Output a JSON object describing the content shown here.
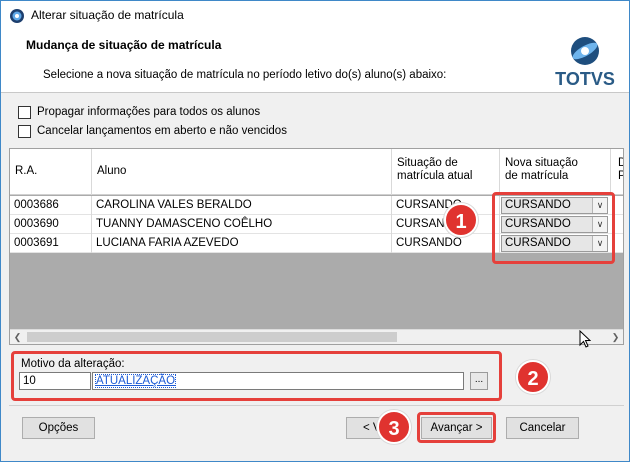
{
  "window": {
    "title": "Alterar situação de matrícula"
  },
  "header": {
    "title": "Mudança de situação de matrícula",
    "subtitle": "Selecione a nova situação de matrícula no período letivo do(s) aluno(s) abaixo:",
    "logo_text": "TOTVS"
  },
  "options": {
    "propagate_label": "Propagar informações para todos os alunos",
    "propagate_checked": false,
    "cancel_label": "Cancelar lançamentos em aberto e não vencidos",
    "cancel_checked": false
  },
  "grid": {
    "columns": [
      "R.A.",
      "Aluno",
      "Situação de matrícula atual",
      "Nova situação de matrícula",
      "D P"
    ],
    "col_ra": "R.A.",
    "col_aluno": "Aluno",
    "col_sit_1": "Situação de",
    "col_sit_2": "matrícula atual",
    "col_nova_1": "Nova situação",
    "col_nova_2": "de matrícula",
    "col_extra_1": "D",
    "col_extra_2": "P",
    "rows": [
      {
        "ra": "0003686",
        "aluno": "CAROLINA VALES BERALDO",
        "atual": "CURSANDO",
        "nova": "CURSANDO"
      },
      {
        "ra": "0003690",
        "aluno": "TUANNY DAMASCENO COÊLHO",
        "atual": "CURSANDO",
        "nova": "CURSANDO"
      },
      {
        "ra": "0003691",
        "aluno": "LUCIANA FARIA AZEVEDO",
        "atual": "CURSANDO",
        "nova": "CURSANDO"
      }
    ]
  },
  "motivo": {
    "label": "Motivo da alteração:",
    "code": "10",
    "description": "ATUALIZAÇÃO",
    "lookup_label": "..."
  },
  "buttons": {
    "options": "Opções",
    "back": "< V",
    "next": "Avançar >",
    "cancel": "Cancelar"
  },
  "annotations": [
    "1",
    "2",
    "3"
  ],
  "colors": {
    "highlight": "#e5403b",
    "badge": "#e0332f",
    "logo": "#2a5b86",
    "link": "#1c5bd6"
  }
}
